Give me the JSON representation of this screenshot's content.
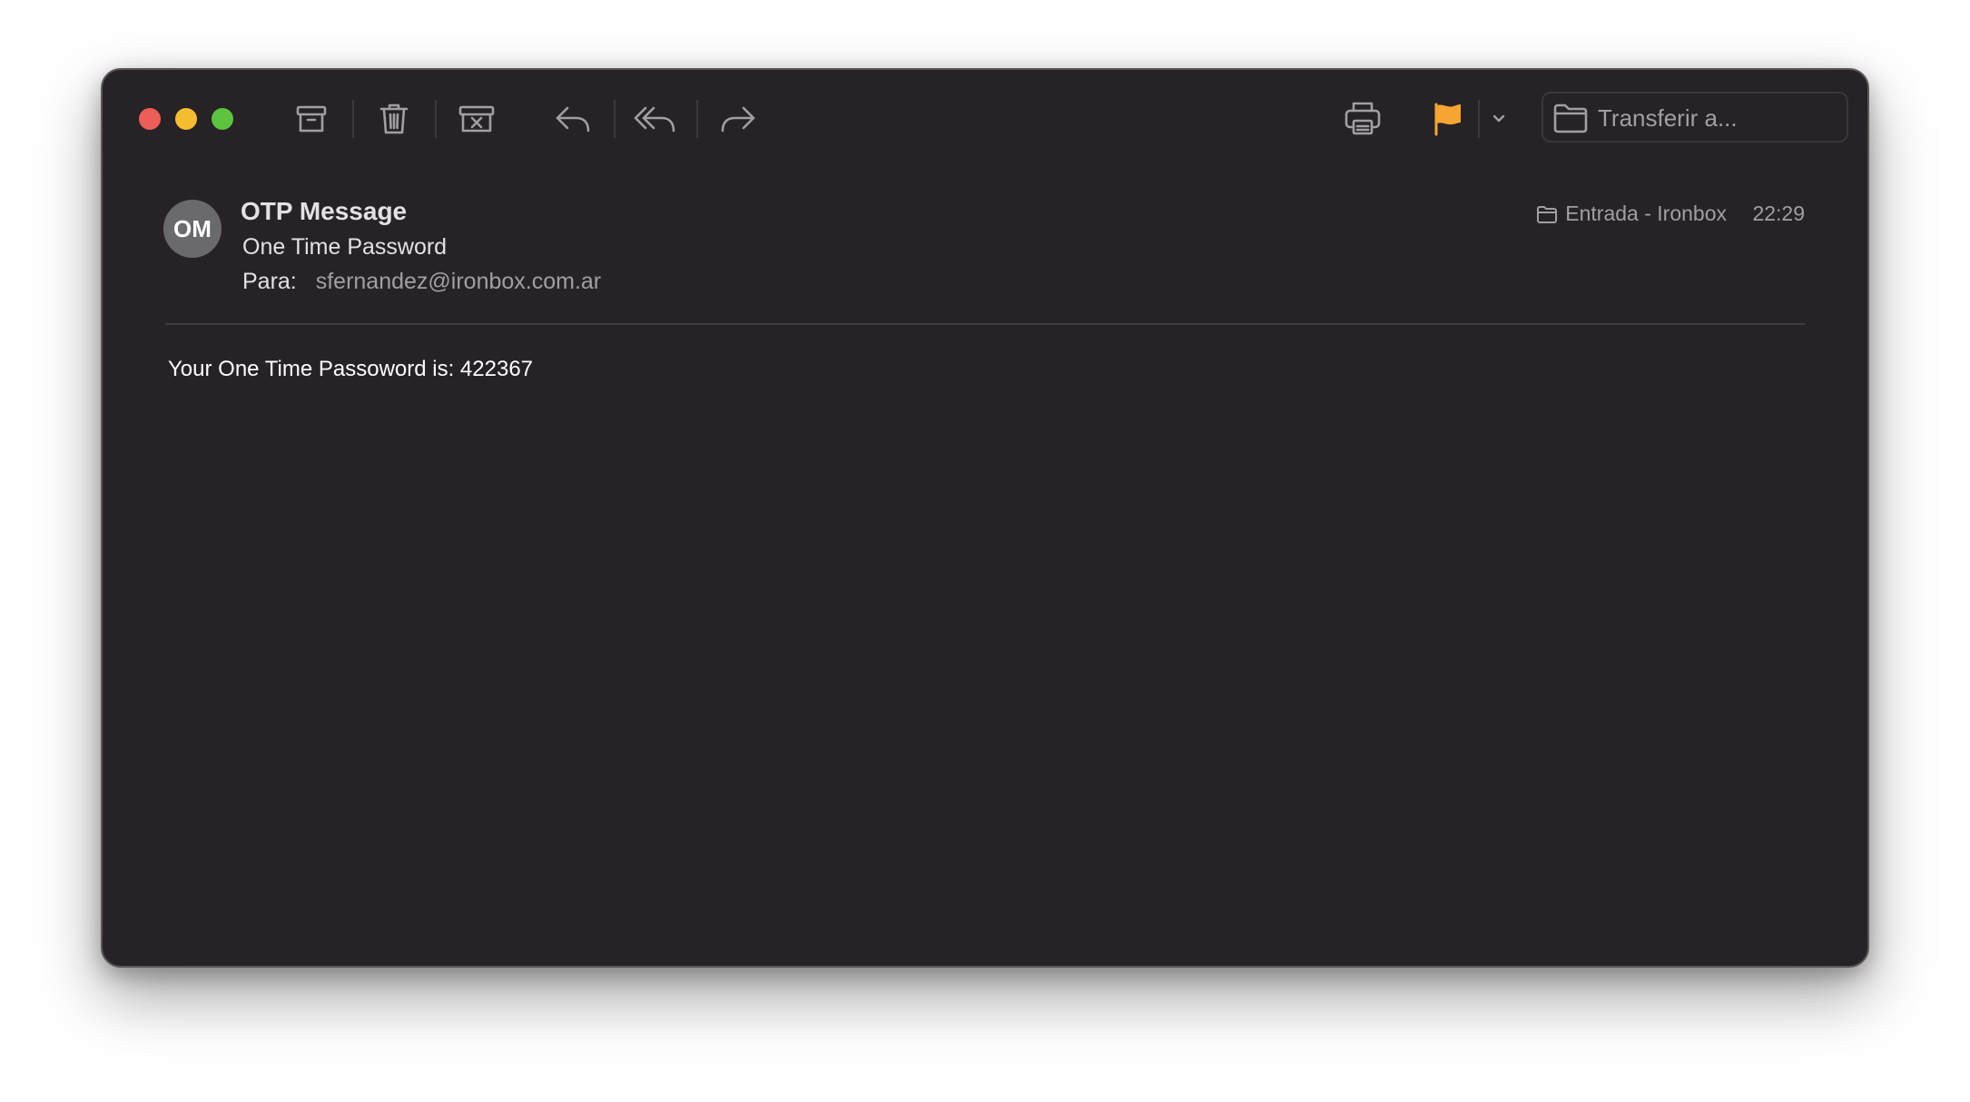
{
  "window": {
    "title": "OTP Message"
  },
  "toolbar": {
    "buttons": [
      {
        "name": "archive",
        "icon": "archive-icon"
      },
      {
        "name": "trash",
        "icon": "trash-icon"
      },
      {
        "name": "junk",
        "icon": "junk-icon"
      },
      {
        "name": "reply",
        "icon": "reply-icon"
      },
      {
        "name": "reply-all",
        "icon": "reply-all-icon"
      },
      {
        "name": "forward",
        "icon": "forward-icon"
      },
      {
        "name": "print",
        "icon": "printer-icon"
      },
      {
        "name": "flag",
        "icon": "flag-icon"
      },
      {
        "name": "flag-menu",
        "icon": "chevron-down-icon"
      }
    ],
    "move_to_placeholder": "Transferir a..."
  },
  "message": {
    "avatar_initials": "OM",
    "sender": "OTP Message",
    "subject": "One Time Password",
    "to_label": "Para:",
    "to_value": "sfernandez@ironbox.com.ar",
    "mailbox": "Entrada - Ironbox",
    "time": "22:29",
    "body": "Your One Time Passoword is: 422367"
  },
  "colors": {
    "background": "#262226",
    "flag": "#f6a531",
    "close": "#ec5f57",
    "minimize": "#f4bd2f",
    "maximize": "#5cc43f",
    "icon": "#a29ea2"
  }
}
